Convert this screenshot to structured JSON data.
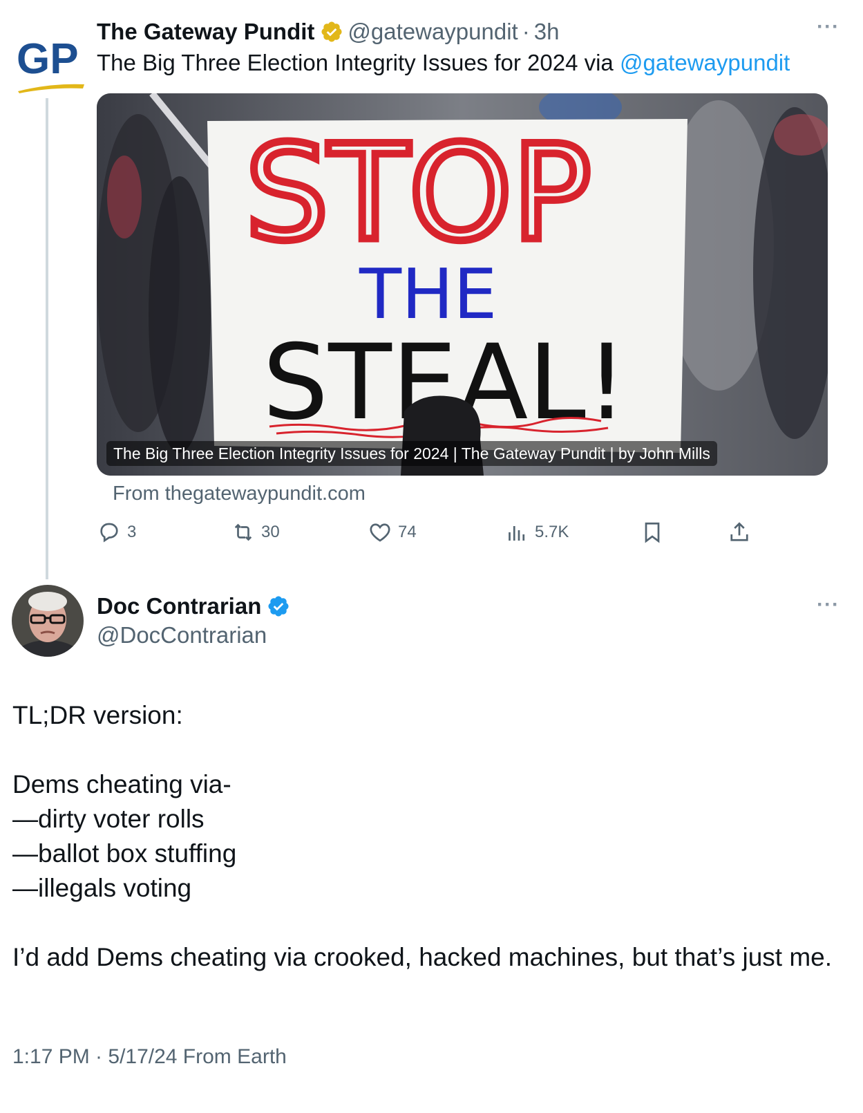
{
  "quoted_tweet": {
    "author": {
      "name": "The Gateway Pundit",
      "handle": "@gatewaypundit",
      "avatar_text": "GP",
      "verified_badge": "gold-check-badge-icon"
    },
    "separator": "·",
    "time": "3h",
    "more_label": "···",
    "text_lead": "The Big Three Election Integrity Issues for 2024 via ",
    "text_link": "@gatewaypundit",
    "card": {
      "image_sign_lines": [
        "STOP",
        "THE",
        "STEAL!"
      ],
      "caption": "The Big Three Election Integrity Issues for 2024 | The Gateway Pundit | by John Mills",
      "source": "From thegatewaypundit.com"
    },
    "actions": {
      "replies": "3",
      "reposts": "30",
      "likes": "74",
      "views": "5.7K"
    },
    "icons": {
      "reply": "reply-icon",
      "repost": "repost-icon",
      "like": "heart-icon",
      "views": "views-icon",
      "bookmark": "bookmark-icon",
      "share": "share-icon"
    }
  },
  "main_tweet": {
    "author": {
      "name": "Doc Contrarian",
      "handle": "@DocContrarian",
      "verified_badge": "blue-check-badge-icon"
    },
    "more_label": "···",
    "intro": "TL;DR version:",
    "lead": "Dems cheating via-",
    "list": [
      "—dirty voter rolls",
      "—ballot box stuffing",
      "—illegals voting"
    ],
    "closing": "I’d add Dems cheating via crooked, hacked machines, but that’s just me.",
    "meta": "1:17 PM · 5/17/24 From Earth"
  },
  "colors": {
    "link": "#1d9bf0",
    "secondary_text": "#536471",
    "gold_badge": "#e2b719",
    "blue_badge": "#1d9bf0",
    "gp_logo_blue": "#1d4f91"
  }
}
